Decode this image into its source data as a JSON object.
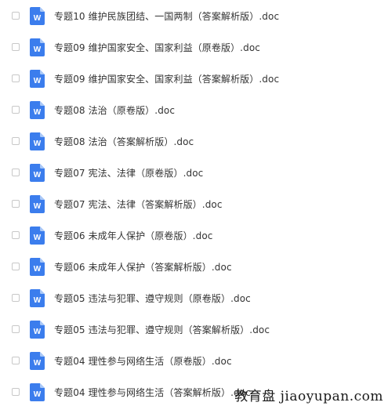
{
  "icon": "word-doc-icon",
  "colors": {
    "icon_blue": "#3b7ded",
    "icon_fold": "#a9c8f7",
    "text": "#333333",
    "checkbox_border": "#c8c8c8"
  },
  "files": [
    {
      "name": "专题10 维护民族团结、一国两制（答案解析版）.doc"
    },
    {
      "name": "专题09 维护国家安全、国家利益（原卷版）.doc"
    },
    {
      "name": "专题09 维护国家安全、国家利益（答案解析版）.doc"
    },
    {
      "name": "专题08 法治（原卷版）.doc"
    },
    {
      "name": "专题08 法治（答案解析版）.doc"
    },
    {
      "name": "专题07 宪法、法律（原卷版）.doc"
    },
    {
      "name": "专题07 宪法、法律（答案解析版）.doc"
    },
    {
      "name": "专题06 未成年人保护（原卷版）.doc"
    },
    {
      "name": "专题06 未成年人保护（答案解析版）.doc"
    },
    {
      "name": "专题05 违法与犯罪、遵守规则（原卷版）.doc"
    },
    {
      "name": "专题05 违法与犯罪、遵守规则（答案解析版）.doc"
    },
    {
      "name": "专题04 理性参与网络生活（原卷版）.doc"
    },
    {
      "name": "专题04 理性参与网络生活（答案解析版）.doc"
    }
  ],
  "watermark": "教育盘 jiaoyupan.com"
}
